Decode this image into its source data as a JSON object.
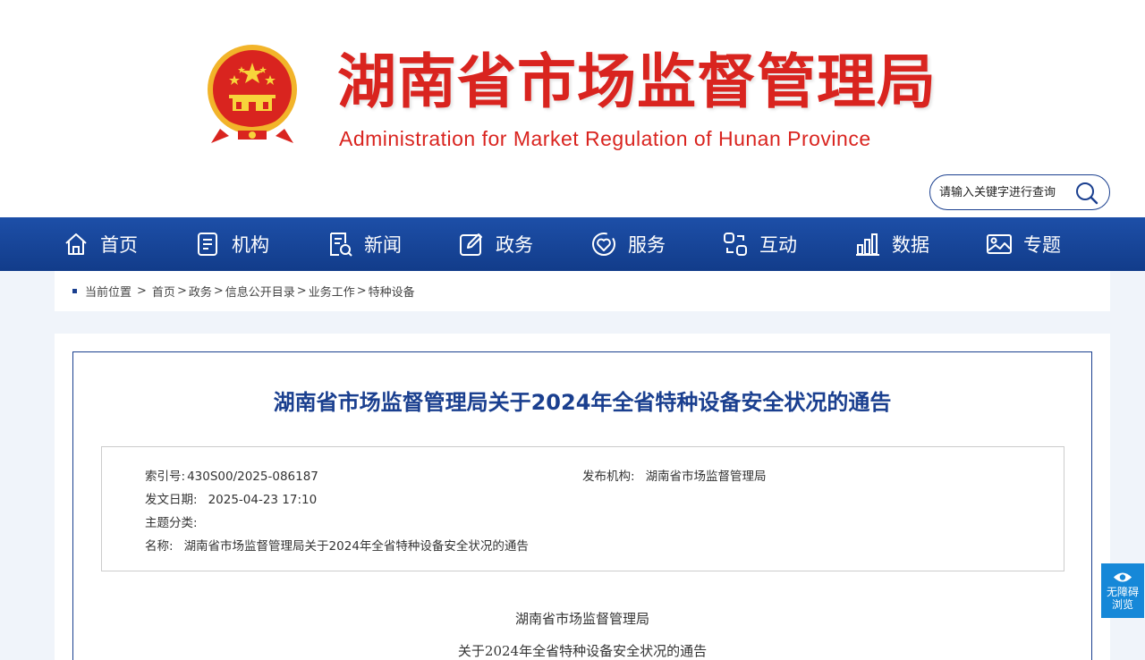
{
  "header": {
    "title": "湖南省市场监督管理局",
    "subtitle": "Administration for Market Regulation of Hunan Province",
    "search_placeholder": "请输入关键字进行查询"
  },
  "nav": [
    {
      "label": "首页",
      "icon": "home-icon"
    },
    {
      "label": "机构",
      "icon": "organization-icon"
    },
    {
      "label": "新闻",
      "icon": "news-icon"
    },
    {
      "label": "政务",
      "icon": "edit-icon"
    },
    {
      "label": "服务",
      "icon": "service-icon"
    },
    {
      "label": "互动",
      "icon": "interaction-icon"
    },
    {
      "label": "数据",
      "icon": "bar-chart-icon"
    },
    {
      "label": "专题",
      "icon": "image-icon"
    }
  ],
  "breadcrumb": {
    "label": "当前位置",
    "sep": ">",
    "items": [
      "首页",
      "政务",
      "信息公开目录",
      "业务工作",
      "特种设备"
    ]
  },
  "article": {
    "title": "湖南省市场监督管理局关于2024年全省特种设备安全状况的通告",
    "meta": {
      "index_label": "索引号:",
      "index_value": "430S00/2025-086187",
      "publisher_label": "发布机构:",
      "publisher_value": "湖南省市场监督管理局",
      "date_label": "发文日期:",
      "date_value": "2025-04-23 17:10",
      "topic_label": "主题分类:",
      "topic_value": "",
      "name_label": "名称:",
      "name_value": "湖南省市场监督管理局关于2024年全省特种设备安全状况的通告"
    },
    "body_lines": [
      "湖南省市场监督管理局",
      "关于2024年全省特种设备安全状况的通告"
    ]
  },
  "accessibility": {
    "line1": "无障碍",
    "line2": "浏览"
  },
  "colors": {
    "brand_red": "#d9241f",
    "nav_blue": "#1d4fa8",
    "title_blue": "#1a3f8f",
    "a11y_blue": "#1688d8"
  }
}
